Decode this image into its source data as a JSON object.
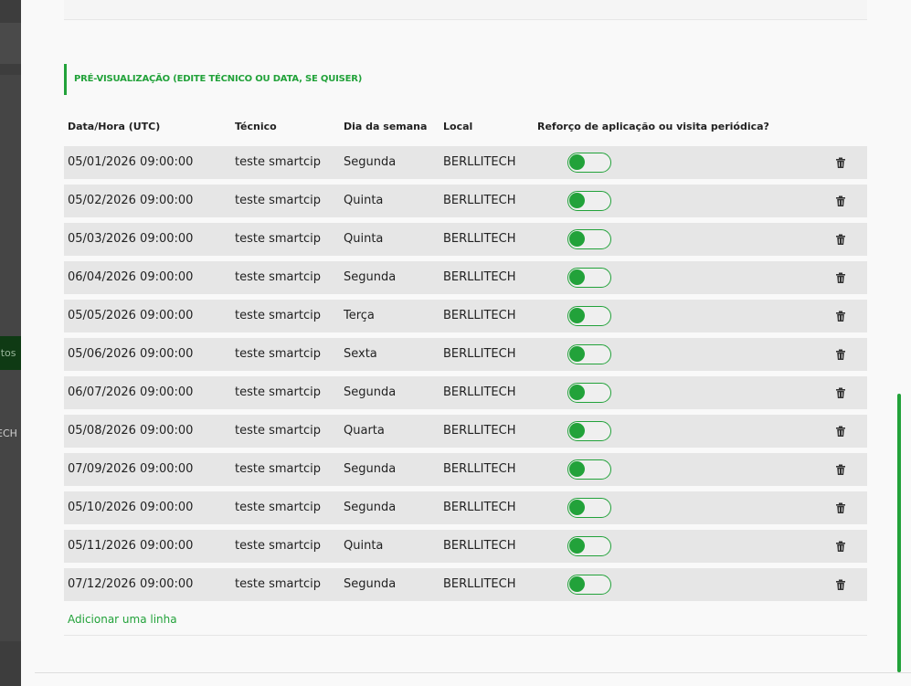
{
  "backdrop": {
    "button_fragment": "atos",
    "text_fragment": "ECH"
  },
  "section": {
    "title": "PRÉ-VISUALIZAÇÃO (EDITE TÉCNICO OU DATA, SE QUISER)"
  },
  "table": {
    "headers": {
      "date": "Data/Hora (UTC)",
      "technician": "Técnico",
      "weekday": "Dia da semana",
      "local": "Local",
      "reinforcement": "Reforço de aplicação ou visita periódica?"
    },
    "rows": [
      {
        "date": "05/01/2026 09:00:00",
        "technician": "teste smartcip",
        "weekday": "Segunda",
        "local": "BERLLITECH",
        "reinforcement": false
      },
      {
        "date": "05/02/2026 09:00:00",
        "technician": "teste smartcip",
        "weekday": "Quinta",
        "local": "BERLLITECH",
        "reinforcement": false
      },
      {
        "date": "05/03/2026 09:00:00",
        "technician": "teste smartcip",
        "weekday": "Quinta",
        "local": "BERLLITECH",
        "reinforcement": false
      },
      {
        "date": "06/04/2026 09:00:00",
        "technician": "teste smartcip",
        "weekday": "Segunda",
        "local": "BERLLITECH",
        "reinforcement": false
      },
      {
        "date": "05/05/2026 09:00:00",
        "technician": "teste smartcip",
        "weekday": "Terça",
        "local": "BERLLITECH",
        "reinforcement": false
      },
      {
        "date": "05/06/2026 09:00:00",
        "technician": "teste smartcip",
        "weekday": "Sexta",
        "local": "BERLLITECH",
        "reinforcement": false
      },
      {
        "date": "06/07/2026 09:00:00",
        "technician": "teste smartcip",
        "weekday": "Segunda",
        "local": "BERLLITECH",
        "reinforcement": false
      },
      {
        "date": "05/08/2026 09:00:00",
        "technician": "teste smartcip",
        "weekday": "Quarta",
        "local": "BERLLITECH",
        "reinforcement": false
      },
      {
        "date": "07/09/2026 09:00:00",
        "technician": "teste smartcip",
        "weekday": "Segunda",
        "local": "BERLLITECH",
        "reinforcement": false
      },
      {
        "date": "05/10/2026 09:00:00",
        "technician": "teste smartcip",
        "weekday": "Segunda",
        "local": "BERLLITECH",
        "reinforcement": false
      },
      {
        "date": "05/11/2026 09:00:00",
        "technician": "teste smartcip",
        "weekday": "Quinta",
        "local": "BERLLITECH",
        "reinforcement": false
      },
      {
        "date": "07/12/2026 09:00:00",
        "technician": "teste smartcip",
        "weekday": "Segunda",
        "local": "BERLLITECH",
        "reinforcement": false
      }
    ],
    "row_icons": {
      "delete": "trash-icon"
    }
  },
  "actions": {
    "add_line": "Adicionar uma linha"
  },
  "colors": {
    "accent": "#22a23a",
    "row_background": "#e6e6e6",
    "modal_background": "#f9f9f9"
  }
}
